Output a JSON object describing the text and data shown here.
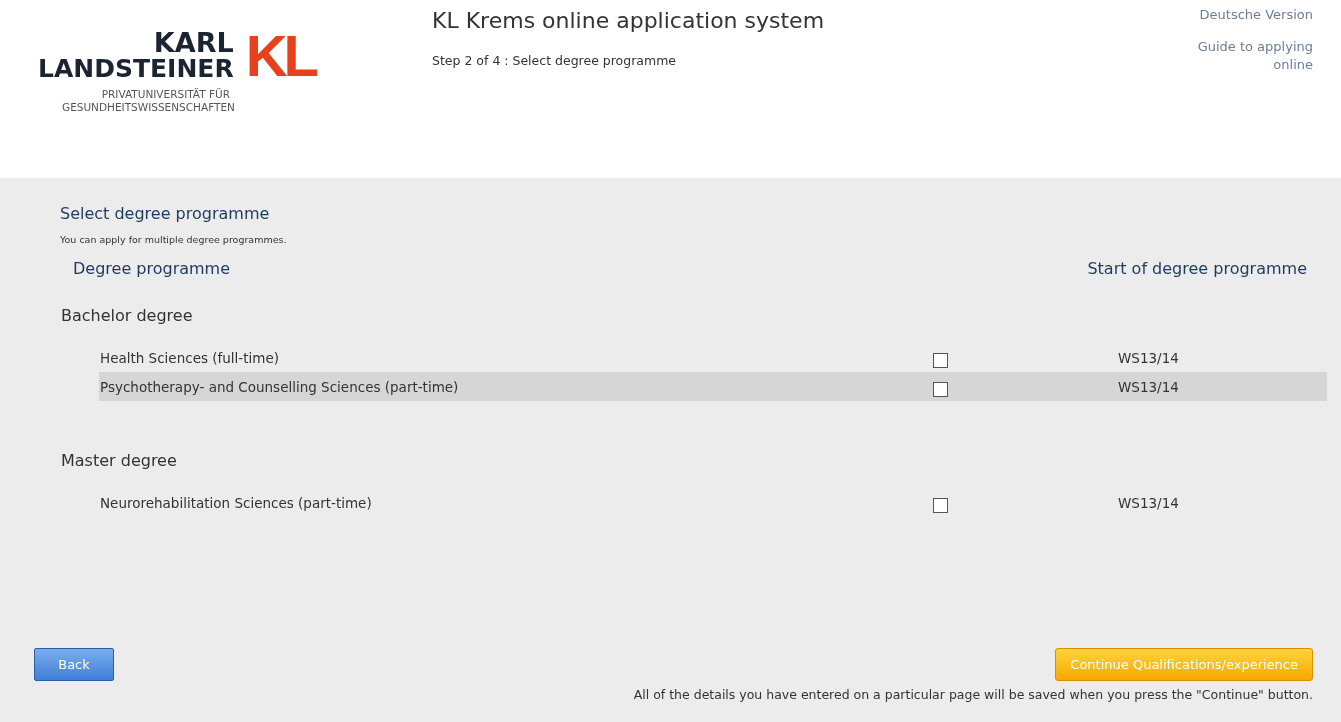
{
  "logo": {
    "line_1": "KARL",
    "line_2": "LANDSTEINER",
    "mark": "KL",
    "subline_1": "PRIVATUNIVERSITÄT FÜR",
    "subline_2": "GESUNDHEITSWISSENSCHAFTEN"
  },
  "header": {
    "title": "KL Krems online application system",
    "step": "Step 2 of 4 : Select degree programme"
  },
  "links": [
    "Deutsche Version",
    "Guide to applying online"
  ],
  "section": {
    "title": "Select degree programme",
    "hint": "You can apply for multiple degree programmes."
  },
  "columns": [
    "Degree programme",
    "Start of degree programme"
  ],
  "groups": [
    {
      "title": "Bachelor degree",
      "rows": [
        {
          "name": "Health Sciences (full-time)",
          "checked": false,
          "selected": false,
          "start": "WS13/14"
        },
        {
          "name": "Psychotherapy- and Counselling Sciences (part-time)",
          "checked": false,
          "selected": true,
          "start": "WS13/14"
        }
      ]
    },
    {
      "title": "Master degree",
      "rows": [
        {
          "name": "Neurorehabilitation Sciences (part-time)",
          "checked": false,
          "selected": false,
          "start": "WS13/14"
        }
      ]
    }
  ],
  "buttons": {
    "back": "Back",
    "continue": "Continue Qualifications/experience"
  },
  "footer_note": "All of the details you have entered on a particular page will be saved when you press the \"Continue\" button."
}
